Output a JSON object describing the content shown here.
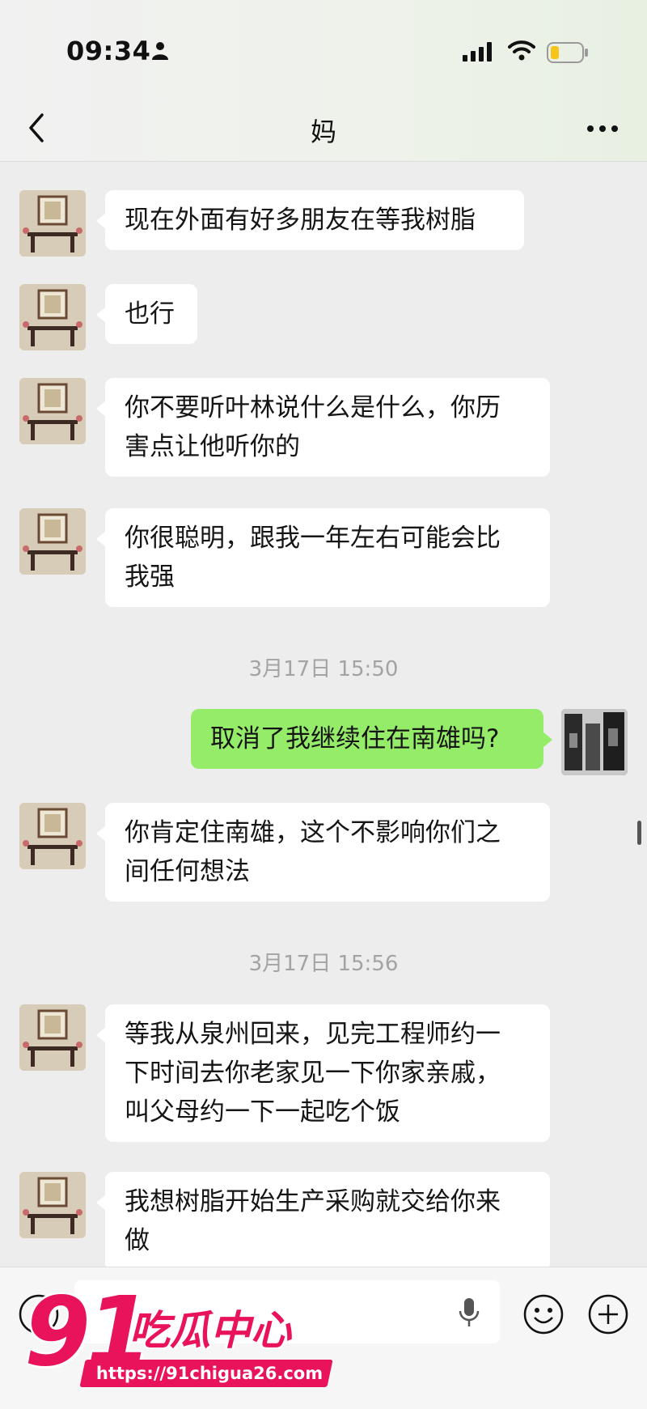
{
  "status_bar": {
    "time": "09:34"
  },
  "header": {
    "title": "妈"
  },
  "messages": [
    {
      "side": "left",
      "text": "现在外面有好多朋友在等我树脂"
    },
    {
      "side": "left",
      "text": "也行"
    },
    {
      "side": "left",
      "text": "你不要听叶林说什么是什么，你历\n害点让他听你的"
    },
    {
      "side": "left",
      "text": "你很聪明，跟我一年左右可能会比\n我强"
    },
    {
      "type": "timestamp",
      "text": "3月17日 15:50"
    },
    {
      "side": "right",
      "text": "取消了我继续住在南雄吗?"
    },
    {
      "side": "left",
      "text": "你肯定住南雄，这个不影响你们之\n间任何想法"
    },
    {
      "type": "timestamp",
      "text": "3月17日 15:56"
    },
    {
      "side": "left",
      "text": "等我从泉州回来，见完工程师约一\n下时间去你老家见一下你家亲戚，\n叫父母约一下一起吃个饭"
    },
    {
      "side": "left",
      "text": "我想树脂开始生产采购就交给你来\n做"
    }
  ],
  "watermark": {
    "number": "91",
    "brand": "吃瓜中心",
    "url": "https://91chigua26.com"
  },
  "colors": {
    "background": "#ededed",
    "my_bubble": "#95ec69",
    "their_bubble": "#ffffff",
    "watermark": "#e8135a"
  },
  "icons": [
    "person-icon",
    "signal-icon",
    "wifi-icon",
    "battery-icon",
    "back-icon",
    "more-icon",
    "voice-icon",
    "mic-icon",
    "emoji-icon",
    "plus-icon"
  ]
}
